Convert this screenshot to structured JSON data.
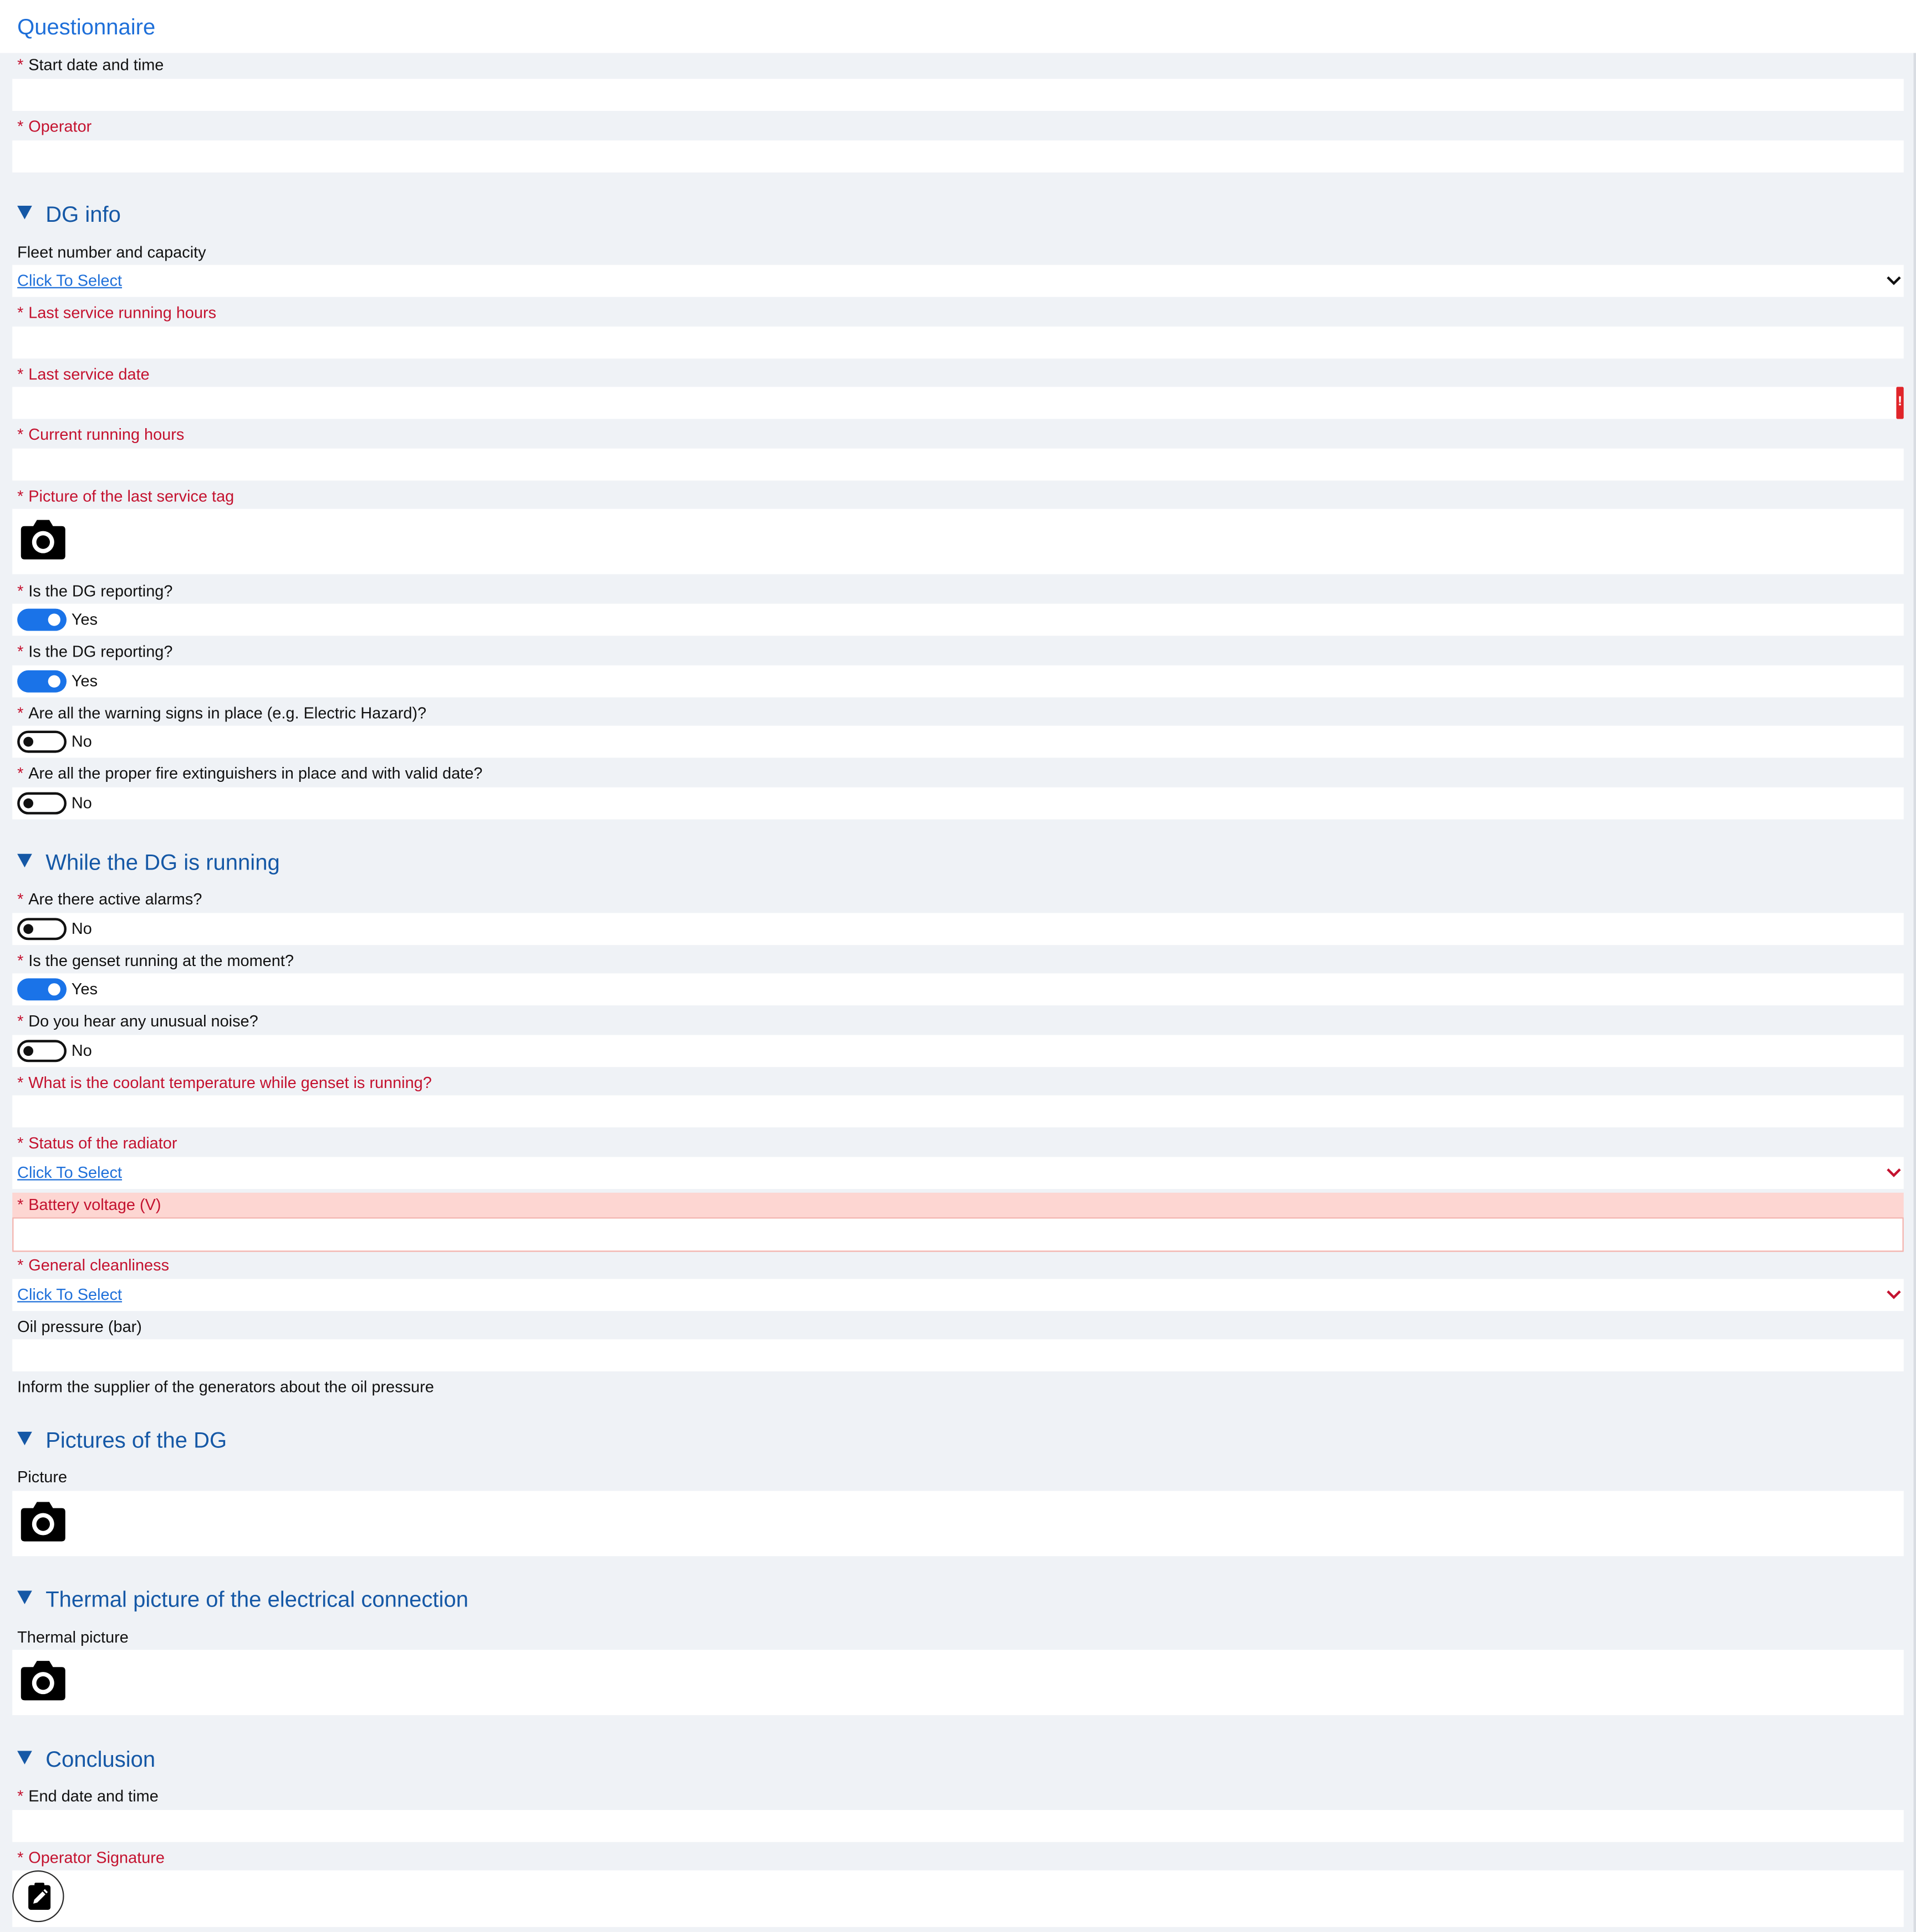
{
  "header": {
    "title": "Questionnaire"
  },
  "select_placeholder": "Click To Select",
  "general": {
    "start_date_label": "Start date and time",
    "operator_label": "Operator"
  },
  "dg_info": {
    "title": "DG info",
    "fleet_label": "Fleet number and capacity",
    "last_service_hours_label": "Last service running hours",
    "last_service_date_label": "Last service date",
    "current_hours_label": "Current running hours",
    "service_tag_picture_label": "Picture of the last service tag",
    "reporting_1": {
      "label": "Is the DG reporting?",
      "value": "Yes",
      "on": true
    },
    "reporting_2": {
      "label": "Is the DG reporting?",
      "value": "Yes",
      "on": true
    },
    "warning_signs": {
      "label": "Are all the warning signs in place (e.g. Electric Hazard)?",
      "value": "No",
      "on": false
    },
    "fire_extinguishers": {
      "label": "Are all the proper fire extinguishers in place and with valid date?",
      "value": "No",
      "on": false
    }
  },
  "running": {
    "title": "While the DG is running",
    "active_alarms": {
      "label": "Are there active alarms?",
      "value": "No",
      "on": false
    },
    "genset_running": {
      "label": "Is the genset running at the moment?",
      "value": "Yes",
      "on": true
    },
    "unusual_noise": {
      "label": "Do you hear any unusual noise?",
      "value": "No",
      "on": false
    },
    "coolant_label": "What is the coolant temperature while genset is running?",
    "radiator_label": "Status of the radiator",
    "battery_label": "Battery voltage (V)",
    "cleanliness_label": "General cleanliness",
    "oil_pressure_label": "Oil pressure (bar)",
    "oil_note": "Inform the supplier of the generators about the oil pressure"
  },
  "pictures": {
    "title": "Pictures of the DG",
    "picture_label": "Picture"
  },
  "thermal": {
    "title": "Thermal picture of the electrical connection",
    "picture_label": "Thermal picture"
  },
  "conclusion": {
    "title": "Conclusion",
    "end_date_label": "End date and time",
    "signature_label": "Operator Signature"
  },
  "icons": {
    "section_toggle": "triangle-down-icon",
    "camera": "camera-icon",
    "chevron": "chevron-down-icon",
    "signature": "signature-pen-icon",
    "error": "error-exclamation-icon"
  },
  "colors": {
    "accent": "#1a73e8",
    "link": "#1e6fd9",
    "section_title": "#1558a6",
    "required_label": "#c4122f",
    "error_bg": "#fdd6d2",
    "page_bg": "#eff2f6"
  }
}
